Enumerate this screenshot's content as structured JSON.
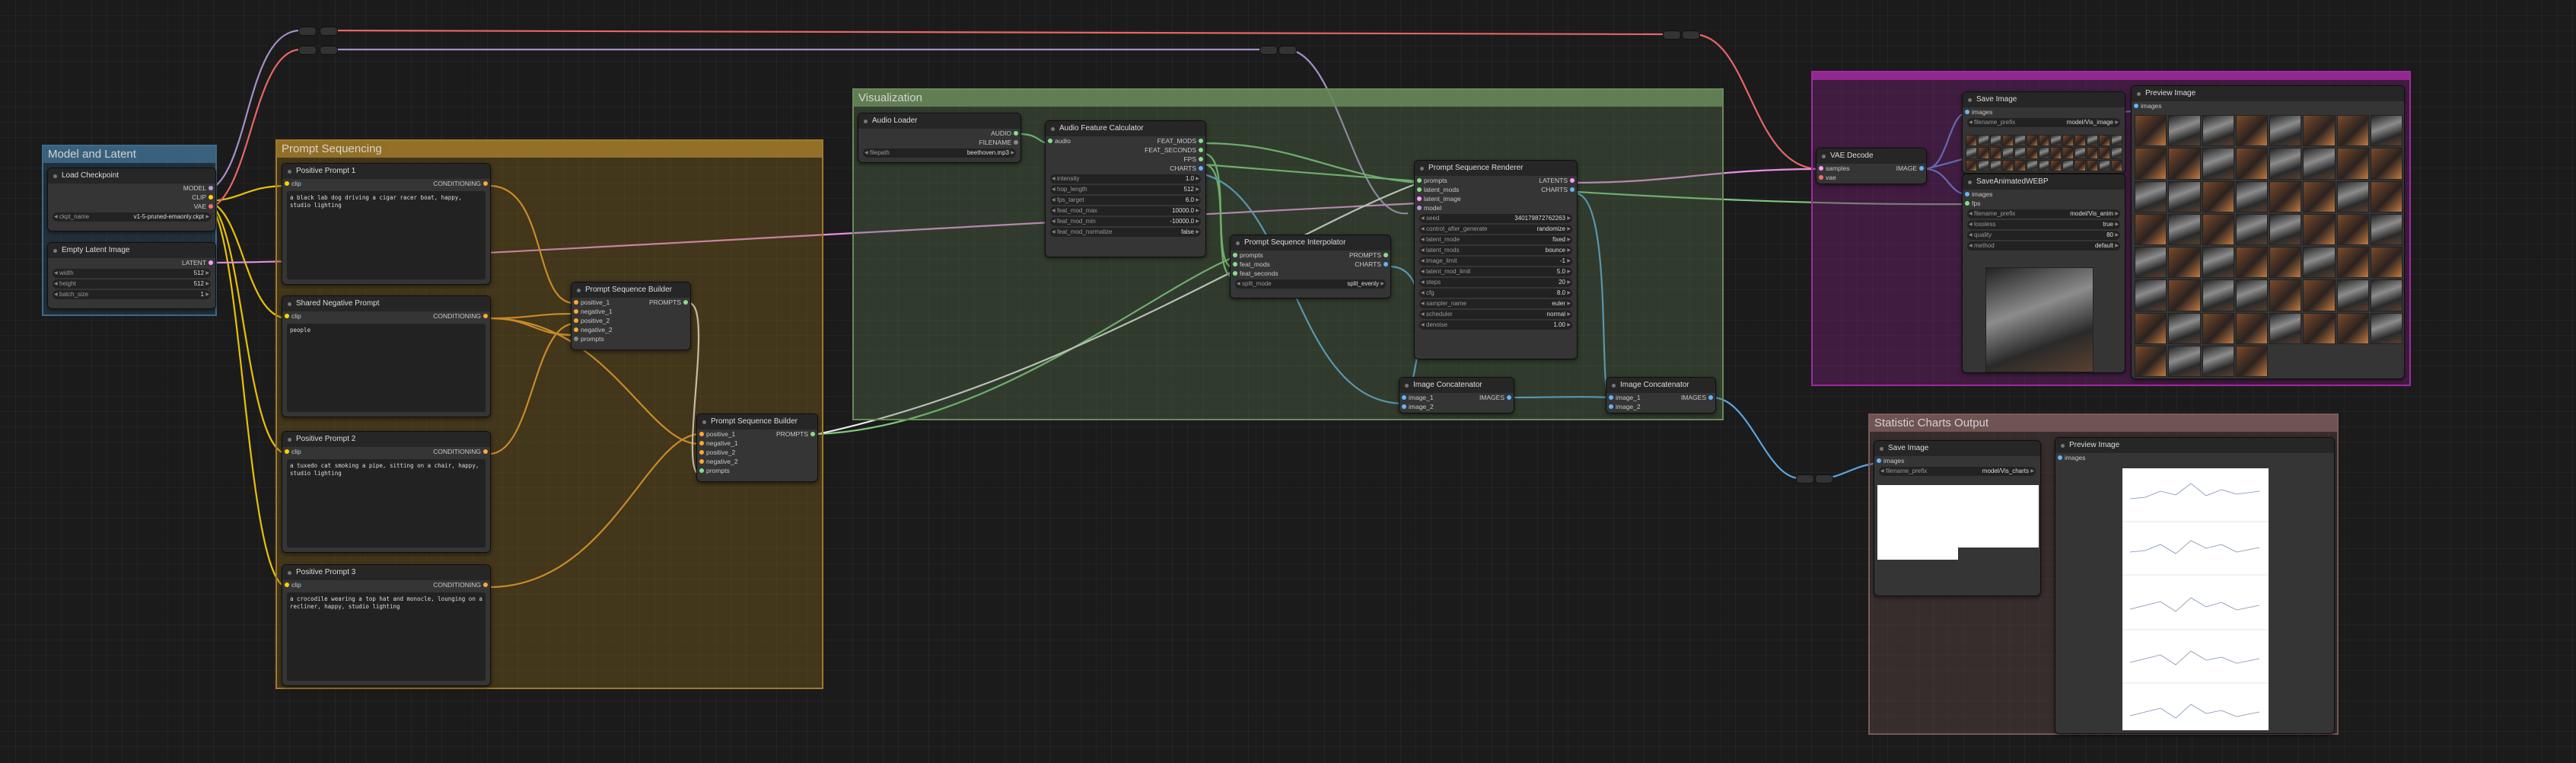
{
  "groups": {
    "model_latent": "Model and Latent",
    "prompt_seq": "Prompt Sequencing",
    "visualization": "Visualization",
    "output_images": "",
    "stat_charts": "Statistic Charts Output"
  },
  "colors": {
    "link_clip": "#ffd500",
    "link_conditioning": "#ffa931",
    "link_latent": "#ff9cf9",
    "link_model": "#b39ddb",
    "link_image": "#64b5f6",
    "link_audio": "#88dd88",
    "link_prompts": "#ffffff"
  },
  "nodes": {
    "load_checkpoint": {
      "title": "Load Checkpoint",
      "out_model": "MODEL",
      "out_clip": "CLIP",
      "out_vae": "VAE",
      "ckpt_label": "ckpt_name",
      "ckpt_value": "v1-5-pruned-emaonly.ckpt"
    },
    "empty_latent": {
      "title": "Empty Latent Image",
      "out": "LATENT",
      "width_label": "width",
      "width": "512",
      "height_label": "height",
      "height": "512",
      "batch_label": "batch_size",
      "batch": "1"
    },
    "pos1": {
      "title": "Positive Prompt 1",
      "in": "clip",
      "out": "CONDITIONING",
      "text": "a black lab dog driving a cigar racer boat, happy, studio lighting"
    },
    "neg": {
      "title": "Shared Negative Prompt",
      "in": "clip",
      "out": "CONDITIONING",
      "text": "people"
    },
    "pos2": {
      "title": "Positive Prompt 2",
      "in": "clip",
      "out": "CONDITIONING",
      "text": "a tuxedo cat smoking a pipe, sitting on a chair, happy, studio lighting"
    },
    "pos3": {
      "title": "Positive Prompt 3",
      "in": "clip",
      "out": "CONDITIONING",
      "text": "a crocodile wearing a top hat and monocle, lounging on a recliner, happy, studio lighting"
    },
    "psb1": {
      "title": "Prompt Sequence Builder",
      "inputs": [
        "positive_1",
        "negative_1",
        "positive_2",
        "negative_2",
        "prompts"
      ],
      "out": "PROMPTS"
    },
    "psb2": {
      "title": "Prompt Sequence Builder",
      "inputs": [
        "positive_1",
        "negative_1",
        "positive_2",
        "negative_2",
        "prompts"
      ],
      "out": "PROMPTS"
    },
    "audio_loader": {
      "title": "Audio Loader",
      "out_audio": "AUDIO",
      "out_filename": "FILENAME",
      "w_label": "filepath",
      "w_value": "beethoven.mp3"
    },
    "apc": {
      "title": "Audio Feature Calculator",
      "in": "audio",
      "outs": [
        "FEAT_MODS",
        "FEAT_SECONDS",
        "FPS",
        "CHARTS"
      ],
      "widgets": [
        [
          "intensity",
          "1.0"
        ],
        [
          "hop_length",
          "512"
        ],
        [
          "fps_target",
          "6.0"
        ],
        [
          "feat_mod_max",
          "10000.0"
        ],
        [
          "feat_mod_min",
          "-10000.0"
        ],
        [
          "feat_mod_normalize",
          "false"
        ]
      ]
    },
    "psi": {
      "title": "Prompt Sequence Interpolator",
      "inputs": [
        "prompts",
        "feat_mods",
        "feat_seconds"
      ],
      "outs": [
        "PROMPTS",
        "CHARTS"
      ],
      "w_label": "split_mode",
      "w_value": "split_evenly"
    },
    "psr": {
      "title": "Prompt Sequence Renderer",
      "inputs": [
        "prompts",
        "latent_mods",
        "latent_image",
        "model"
      ],
      "outs": [
        "LATENTS",
        "CHARTS"
      ],
      "widgets": [
        [
          "seed",
          "340179872762263"
        ],
        [
          "control_after_generate",
          "randomize"
        ],
        [
          "latent_mode",
          "fixed"
        ],
        [
          "latent_mods",
          "bounce"
        ],
        [
          "image_limit",
          "-1"
        ],
        [
          "latent_mod_limit",
          "5.0"
        ],
        [
          "steps",
          "20"
        ],
        [
          "cfg",
          "8.0"
        ],
        [
          "sampler_name",
          "euler"
        ],
        [
          "scheduler",
          "normal"
        ],
        [
          "denoise",
          "1.00"
        ]
      ]
    },
    "ic1": {
      "title": "Image Concatenator",
      "inputs": [
        "image_1",
        "image_2"
      ],
      "out": "IMAGES"
    },
    "ic2": {
      "title": "Image Concatenator",
      "inputs": [
        "image_1",
        "image_2"
      ],
      "out": "IMAGES"
    },
    "vae_decode": {
      "title": "VAE Decode",
      "inputs": [
        "samples",
        "vae"
      ],
      "out": "IMAGE"
    },
    "save_image": {
      "title": "Save Image",
      "in": "images",
      "w_label": "filename_prefix",
      "w_value": "model/Vis_image"
    },
    "save_webp": {
      "title": "SaveAnimatedWEBP",
      "inputs": [
        "images",
        "fps"
      ],
      "widgets": [
        [
          "filename_prefix",
          "model/Vis_anim"
        ],
        [
          "lossless",
          "true"
        ],
        [
          "quality",
          "80"
        ],
        [
          "method",
          "default"
        ]
      ]
    },
    "preview_image": {
      "title": "Preview Image",
      "in": "images"
    },
    "save_charts": {
      "title": "Save Image",
      "in": "images",
      "w_label": "filename_prefix",
      "w_value": "model/Vis_charts"
    },
    "preview_charts": {
      "title": "Preview Image",
      "in": "images"
    }
  }
}
